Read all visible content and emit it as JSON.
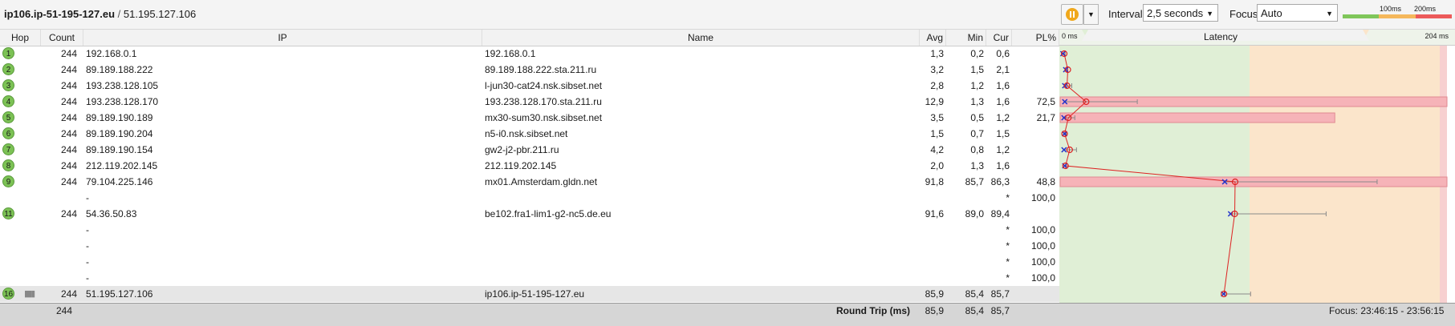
{
  "header": {
    "host": "ip106.ip-51-195-127.eu",
    "separator": " / ",
    "ip": "51.195.127.106",
    "interval_label": "Interval",
    "interval_value": "2,5 seconds",
    "focus_label": "Focus",
    "focus_value": "Auto",
    "legend_100": "100ms",
    "legend_200": "200ms",
    "colors": {
      "green": "#7fc65a",
      "orange": "#f5b85c",
      "red": "#ec5a5a",
      "pause": "#f0a81c"
    }
  },
  "columns": {
    "hop": "Hop",
    "count": "Count",
    "ip": "IP",
    "name": "Name",
    "avg": "Avg",
    "min": "Min",
    "cur": "Cur",
    "pl": "PL%"
  },
  "latency": {
    "title": "Latency",
    "min_label": "0 ms",
    "max_label": "204 ms",
    "max_ms": 204
  },
  "rows": [
    {
      "hop": "1",
      "count": "244",
      "ip": "192.168.0.1",
      "name": "192.168.0.1",
      "avg": "1,3",
      "min": "0,2",
      "cur": "0,6",
      "pl": "",
      "bar": 0,
      "hi": 1.8
    },
    {
      "hop": "2",
      "count": "244",
      "ip": "89.189.188.222",
      "name": "89.189.188.222.sta.211.ru",
      "avg": "3,2",
      "min": "1,5",
      "cur": "2,1",
      "pl": "",
      "bar": 0,
      "hi": 2.5
    },
    {
      "hop": "3",
      "count": "244",
      "ip": "193.238.128.105",
      "name": "l-jun30-cat24.nsk.sibset.net",
      "avg": "2,8",
      "min": "1,2",
      "cur": "1,6",
      "pl": "",
      "bar": 0,
      "hi": 5.3
    },
    {
      "hop": "4",
      "count": "244",
      "ip": "193.238.128.170",
      "name": "193.238.128.170.sta.211.ru",
      "avg": "12,9",
      "min": "1,3",
      "cur": "1,6",
      "pl": "72,5",
      "bar": 100,
      "hi": 40
    },
    {
      "hop": "5",
      "count": "244",
      "ip": "89.189.190.189",
      "name": "mx30-sum30.nsk.sibset.net",
      "avg": "3,5",
      "min": "0,5",
      "cur": "1,2",
      "pl": "21,7",
      "bar": 71,
      "hi": 6.9
    },
    {
      "hop": "6",
      "count": "244",
      "ip": "89.189.190.204",
      "name": "n5-i0.nsk.sibset.net",
      "avg": "1,5",
      "min": "0,7",
      "cur": "1,5",
      "pl": "",
      "bar": 0,
      "hi": 2.5
    },
    {
      "hop": "7",
      "count": "244",
      "ip": "89.189.190.154",
      "name": "gw2-j2-pbr.211.ru",
      "avg": "4,2",
      "min": "0,8",
      "cur": "1,2",
      "pl": "",
      "bar": 0,
      "hi": 7.8
    },
    {
      "hop": "8",
      "count": "244",
      "ip": "212.119.202.145",
      "name": "212.119.202.145",
      "avg": "2,0",
      "min": "1,3",
      "cur": "1,6",
      "pl": "",
      "bar": 0,
      "hi": 2.1
    },
    {
      "hop": "9",
      "count": "244",
      "ip": "79.104.225.146",
      "name": "mx01.Amsterdam.gldn.net",
      "avg": "91,8",
      "min": "85,7",
      "cur": "86,3",
      "pl": "48,8",
      "bar": 100,
      "hi": 167
    },
    {
      "hop": "",
      "count": "",
      "ip": "-",
      "name": "",
      "avg": "",
      "min": "",
      "cur": "*",
      "pl": "100,0",
      "bar": 0,
      "hi": null
    },
    {
      "hop": "11",
      "count": "244",
      "ip": "54.36.50.83",
      "name": "be102.fra1-lim1-g2-nc5.de.eu",
      "avg": "91,6",
      "min": "89,0",
      "cur": "89,4",
      "pl": "",
      "bar": 0,
      "hi": 140
    },
    {
      "hop": "",
      "count": "",
      "ip": "-",
      "name": "",
      "avg": "",
      "min": "",
      "cur": "*",
      "pl": "100,0",
      "bar": 0,
      "hi": null
    },
    {
      "hop": "",
      "count": "",
      "ip": "-",
      "name": "",
      "avg": "",
      "min": "",
      "cur": "*",
      "pl": "100,0",
      "bar": 0,
      "hi": null
    },
    {
      "hop": "",
      "count": "",
      "ip": "-",
      "name": "",
      "avg": "",
      "min": "",
      "cur": "*",
      "pl": "100,0",
      "bar": 0,
      "hi": null
    },
    {
      "hop": "",
      "count": "",
      "ip": "-",
      "name": "",
      "avg": "",
      "min": "",
      "cur": "*",
      "pl": "100,0",
      "bar": 0,
      "hi": null
    },
    {
      "hop": "16",
      "count": "244",
      "ip": "51.195.127.106",
      "name": "ip106.ip-51-195-127.eu",
      "avg": "85,9",
      "min": "85,4",
      "cur": "85,7",
      "pl": "",
      "bar": 0,
      "hi": 100
    }
  ],
  "footer": {
    "count": "244",
    "label": "Round Trip (ms)",
    "avg": "85,9",
    "min": "85,4",
    "cur": "85,7",
    "focus": "Focus: 23:46:15 - 23:56:15"
  }
}
